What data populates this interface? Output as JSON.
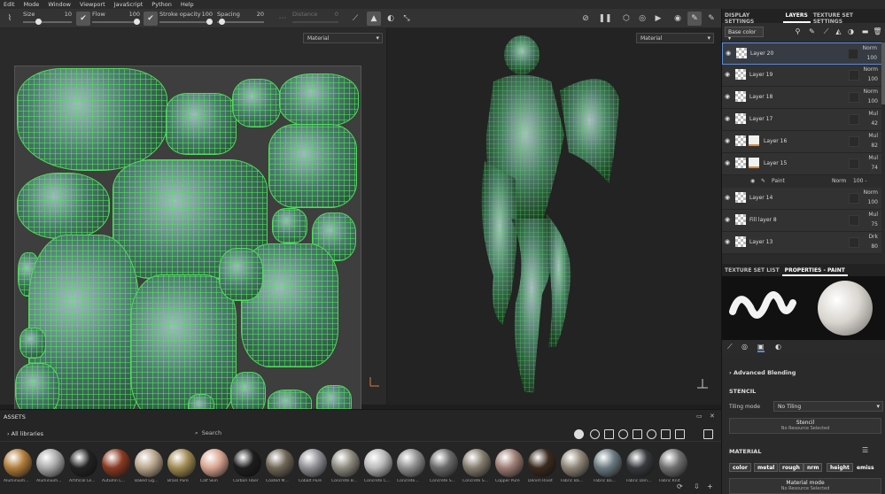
{
  "menu": [
    "Edit",
    "Mode",
    "Window",
    "Viewport",
    "JavaScript",
    "Python",
    "Help"
  ],
  "toolbar": {
    "size": {
      "label": "Size",
      "value": "10",
      "level": 0.25
    },
    "flow": {
      "label": "Flow",
      "value": "100",
      "level": 1.0
    },
    "stroke_opacity": {
      "label": "Stroke opacity",
      "value": "100",
      "level": 1.0
    },
    "spacing": {
      "label": "Spacing",
      "value": "20",
      "level": 0.05
    },
    "symmetry": {
      "label": "Distance",
      "value": "0"
    }
  },
  "viewport2d": {
    "material_select": "Material"
  },
  "viewport3d": {
    "material_select": "Material"
  },
  "assets": {
    "title": "ASSETS",
    "all_libraries": "All libraries",
    "search_placeholder": "Search",
    "materials": [
      {
        "name": "Aluminium...",
        "color": "#b07d3a"
      },
      {
        "name": "Aluminium...",
        "color": "#a9a9a9"
      },
      {
        "name": "Artificial Le...",
        "color": "#222222"
      },
      {
        "name": "Autumn L...",
        "color": "#8a3a22"
      },
      {
        "name": "Baked Lig...",
        "color": "#b9a58b"
      },
      {
        "name": "Brass Pure",
        "color": "#9f8a52"
      },
      {
        "name": "Calf Skin",
        "color": "#d8a48f"
      },
      {
        "name": "Carbon Fiber",
        "color": "#1d1d1d"
      },
      {
        "name": "Coated M...",
        "color": "#6f6656"
      },
      {
        "name": "Cobalt Pure",
        "color": "#8f8f94"
      },
      {
        "name": "Concrete B...",
        "color": "#8d8a7f"
      },
      {
        "name": "Concrete C...",
        "color": "#b8b8b8"
      },
      {
        "name": "Concrete...",
        "color": "#8f8f8f"
      },
      {
        "name": "Concrete S...",
        "color": "#6a6a6a"
      },
      {
        "name": "Concrete S...",
        "color": "#857d6e"
      },
      {
        "name": "Copper Pure",
        "color": "#9c7d73"
      },
      {
        "name": "Denim Rivet",
        "color": "#3a2a1e"
      },
      {
        "name": "Fabric Ba...",
        "color": "#8e8575"
      },
      {
        "name": "Fabric Bo...",
        "color": "#6a7a80"
      },
      {
        "name": "Fabric Den...",
        "color": "#38393d"
      },
      {
        "name": "Fabric Knit",
        "color": "#707070"
      }
    ]
  },
  "right_panel": {
    "tabs": [
      "DISPLAY SETTINGS",
      "LAYERS",
      "TEXTURE SET SETTINGS"
    ],
    "channel": "Base color",
    "layers": [
      {
        "name": "Layer 20",
        "blend": "Norm",
        "opacity": "100",
        "selected": true,
        "mask": false
      },
      {
        "name": "Layer 19",
        "blend": "Norm",
        "opacity": "100",
        "selected": false,
        "mask": false
      },
      {
        "name": "Layer 18",
        "blend": "Norm",
        "opacity": "100",
        "selected": false,
        "mask": false
      },
      {
        "name": "Layer 17",
        "blend": "Mul",
        "opacity": "42",
        "selected": false,
        "mask": false
      },
      {
        "name": "Layer 16",
        "blend": "Mul",
        "opacity": "82",
        "selected": false,
        "mask": true
      },
      {
        "name": "Layer 15",
        "blend": "Mul",
        "opacity": "74",
        "selected": false,
        "mask": true
      }
    ],
    "effect": {
      "name": "Paint",
      "blend": "Norm",
      "opacity": "100 -"
    },
    "layers_after": [
      {
        "name": "Layer 14",
        "blend": "Norm",
        "opacity": "100"
      },
      {
        "name": "Fill layer 8",
        "blend": "Mul",
        "opacity": "75"
      },
      {
        "name": "Layer 13",
        "blend": "Drk",
        "opacity": "80"
      }
    ],
    "props_tabs": [
      "TEXTURE SET LIST",
      "PROPERTIES - PAINT"
    ],
    "advanced_blending": "Advanced Blending",
    "stencil": {
      "title": "STENCIL",
      "tiling_label": "Tiling mode",
      "tiling_value": "No Tiling",
      "res_title": "Stencil",
      "res_sub": "No Resource Selected"
    },
    "material": {
      "title": "MATERIAL",
      "chips": [
        "color",
        "metal",
        "rough",
        "nrm",
        "height",
        "emiss"
      ],
      "mode_title": "Material mode",
      "mode_sub": "No Resource Selected"
    }
  }
}
